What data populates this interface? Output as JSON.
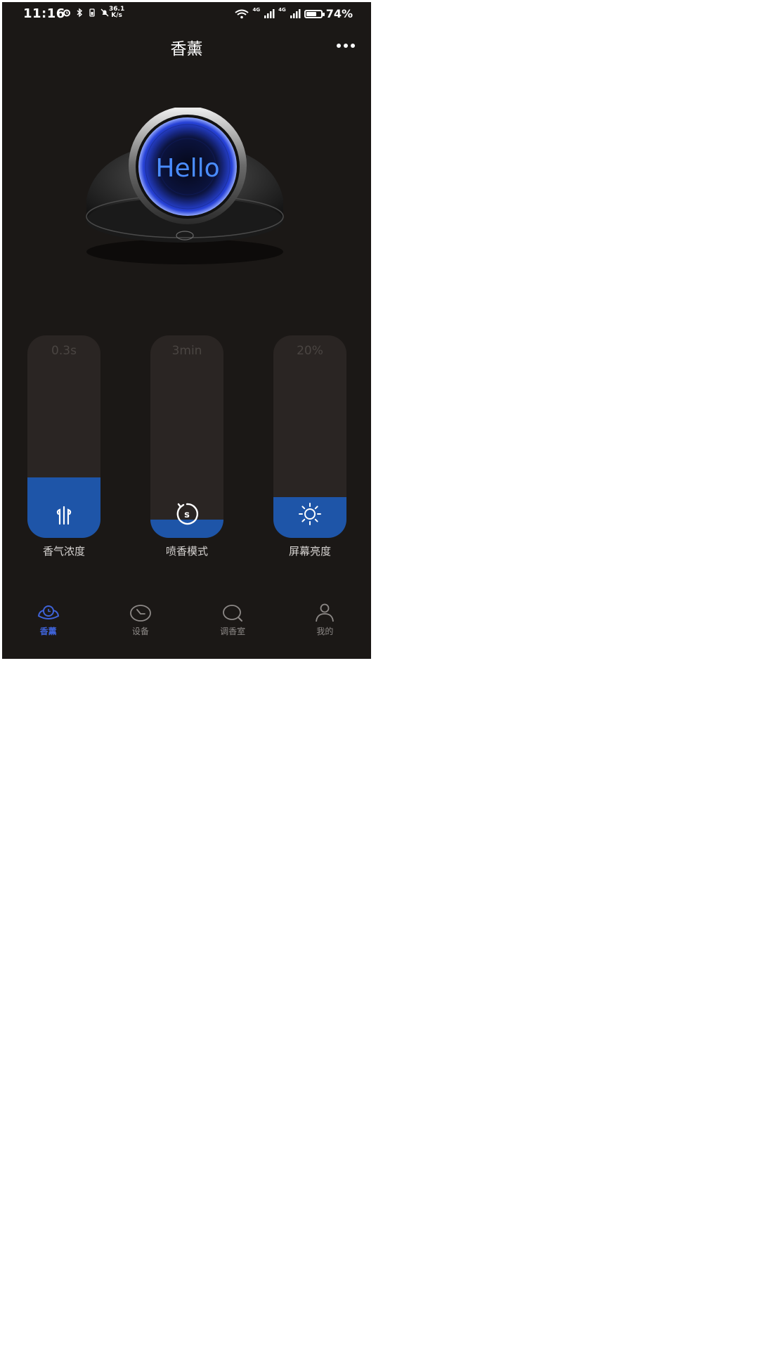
{
  "status_bar": {
    "time": "11:16",
    "net_speed_value": "36.1",
    "net_speed_unit": "K/s",
    "signal_1": "4G",
    "signal_2": "4G",
    "battery_percent": "74%",
    "battery_level": 0.74
  },
  "header": {
    "title": "香薰",
    "more_icon": "more-dots-icon"
  },
  "device": {
    "display_text": "Hello"
  },
  "sliders": [
    {
      "value_text": "0.3s",
      "label": "香气浓度",
      "level": 0.3,
      "icon": "scent-wave-icon"
    },
    {
      "value_text": "3min",
      "label": "喷香模式",
      "level": 0.09,
      "icon": "timer-s-icon"
    },
    {
      "value_text": "20%",
      "label": "屏幕亮度",
      "level": 0.2,
      "icon": "sun-icon"
    }
  ],
  "bottom_nav": {
    "items": [
      {
        "label": "香薰",
        "icon": "diffuser-icon",
        "active": true
      },
      {
        "label": "设备",
        "icon": "clock-icon",
        "active": false
      },
      {
        "label": "调香室",
        "icon": "search-icon",
        "active": false
      },
      {
        "label": "我的",
        "icon": "user-icon",
        "active": false
      }
    ]
  },
  "colors": {
    "background": "#1b1816",
    "accent": "#1e55a8",
    "active_nav": "#3f63d8",
    "track": "#2a2523"
  }
}
